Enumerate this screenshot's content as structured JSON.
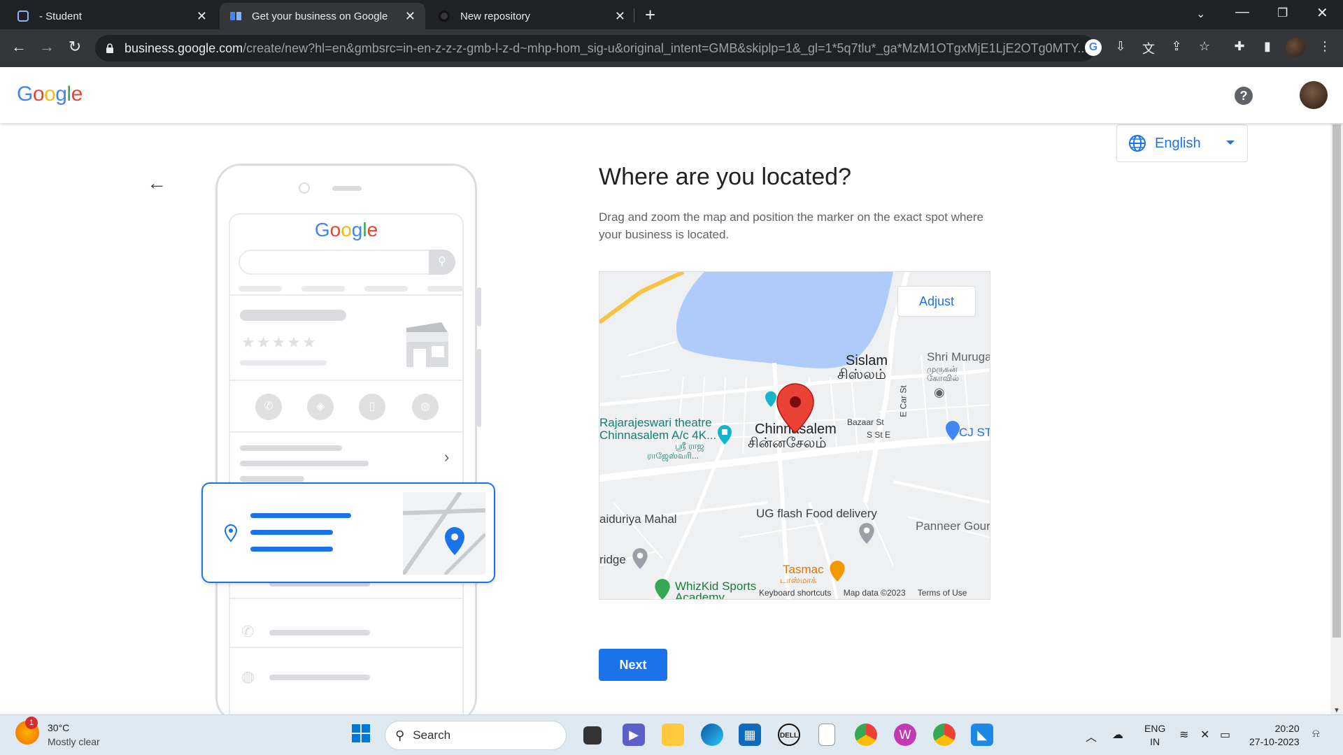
{
  "browser": {
    "tabs": [
      {
        "title": "- Student"
      },
      {
        "title": "Get your business on Google"
      },
      {
        "title": "New repository"
      }
    ],
    "url_domain": "business.google.com",
    "url_path": "/create/new?hl=en&gmbsrc=in-en-z-z-z-gmb-l-z-d~mhp-hom_sig-u&original_intent=GMB&skiplp=1&_gl=1*5q7tlu*_ga*MzM1OTgxMjE1LjE2OTg0MTY..."
  },
  "header": {
    "logo": "Google"
  },
  "language": {
    "selected": "English"
  },
  "illustration": {
    "logo": "Google"
  },
  "page": {
    "title": "Where are you located?",
    "description": "Drag and zoom the map and position the marker on the exact spot where your business is located."
  },
  "map": {
    "adjust_label": "Adjust",
    "labels": {
      "sislam_en": "Sislam",
      "sislam_ta": "சிஸ்லம்",
      "shri_muruga": "Shri Muruga",
      "muruga_ta1": "முருகன்",
      "muruga_ta2": "கோவில்",
      "theatre_1": "Rajarajeswari theatre",
      "theatre_2": "Chinnasalem A/c 4K...",
      "theatre_ta1": "ஸ்ரீ ராஜ",
      "theatre_ta2": "ராஜேஸ்வரி...",
      "chinnasalem_en": "Chinnasalem",
      "chinnasalem_ta": "சின்னசேலம்",
      "bazaar": "Bazaar St",
      "sst": "S St E",
      "ecar": "E Car St",
      "cj": "CJ ST",
      "vaiduriya": "aiduriya Mahal",
      "ug": "UG flash Food delivery",
      "panneer": "Panneer Gour",
      "bridge": "ridge",
      "tasmac": "Tasmac",
      "tasmac_ta": "டாஸ்மாக்",
      "whizkid_1": "WhizKid Sports",
      "whizkid_2": "Academy"
    },
    "footer": {
      "shortcuts": "Keyboard shortcuts",
      "data": "Map data ©2023",
      "terms": "Terms of Use"
    }
  },
  "actions": {
    "next_label": "Next"
  },
  "taskbar": {
    "weather_temp": "30°C",
    "weather_desc": "Mostly clear",
    "weather_badge": "1",
    "search_label": "Search",
    "lang_line1": "ENG",
    "lang_line2": "IN",
    "time": "20:20",
    "date": "27-10-2023"
  },
  "colors": {
    "accent": "#1a73e8",
    "marker": "#ea4335",
    "water": "#aecbfa"
  }
}
